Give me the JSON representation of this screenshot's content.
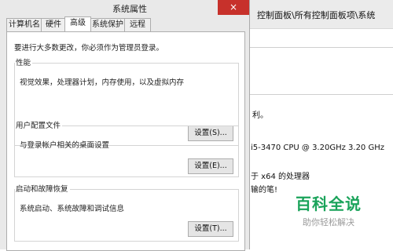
{
  "background_window": {
    "address": "控制面板\\所有控制面板项\\系统",
    "text_1": "利。",
    "cpu": "i5-3470 CPU @ 3.20GHz   3.20 GHz",
    "text_2": "于 x64 的处理器",
    "text_3": "输的笔!"
  },
  "watermark": {
    "title": "百科全说",
    "subtitle": "助你轻松解决"
  },
  "dialog": {
    "title": "系统属性",
    "close_symbol": "×",
    "tabs": [
      "计算机名",
      "硬件",
      "高级",
      "系统保护",
      "远程"
    ],
    "active_tab": "高级",
    "admin_note": "要进行大多数更改，你必须作为管理员登录。",
    "groups": [
      {
        "title": "性能",
        "description": "视觉效果，处理器计划，内存使用，以及虚拟内存",
        "button": "设置(S)..."
      },
      {
        "title": "用户配置文件",
        "description": "与登录帐户相关的桌面设置",
        "button": "设置(E)..."
      },
      {
        "title": "启动和故障恢复",
        "description": "系统启动、系统故障和调试信息",
        "button": "设置(T)..."
      }
    ]
  }
}
